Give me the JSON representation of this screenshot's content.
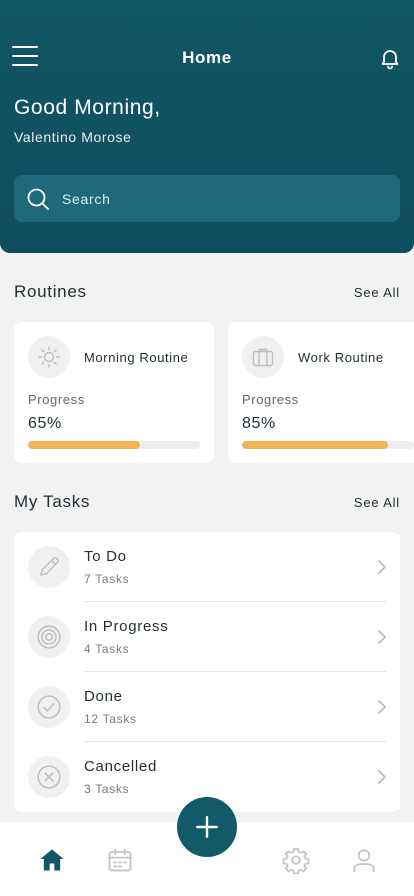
{
  "header": {
    "title": "Home",
    "greeting": "Good Morning,",
    "username": "Valentino Morose",
    "search_placeholder": "Search"
  },
  "routines": {
    "title": "Routines",
    "see_all": "See All",
    "items": [
      {
        "name": "Morning Routine",
        "icon": "sun-icon",
        "progress_label": "Progress",
        "progress_text": "65%",
        "progress": 0.65
      },
      {
        "name": "Work Routine",
        "icon": "briefcase-icon",
        "progress_label": "Progress",
        "progress_text": "85%",
        "progress": 0.85
      }
    ]
  },
  "tasks": {
    "title": "My Tasks",
    "see_all": "See All",
    "items": [
      {
        "title": "To Do",
        "count": "7 Tasks",
        "icon": "pencil-icon"
      },
      {
        "title": "In Progress",
        "count": "4 Tasks",
        "icon": "target-icon"
      },
      {
        "title": "Done",
        "count": "12 Tasks",
        "icon": "check-circle-icon"
      },
      {
        "title": "Cancelled",
        "count": "3 Tasks",
        "icon": "x-circle-icon"
      }
    ]
  },
  "nav": {
    "items": [
      "home-icon",
      "calendar-icon",
      "gear-icon",
      "user-icon"
    ],
    "fab_icon": "plus-icon"
  },
  "colors": {
    "header": "#135665",
    "accent": "#f3b352",
    "fab": "#125a68",
    "active_nav": "#135665"
  }
}
